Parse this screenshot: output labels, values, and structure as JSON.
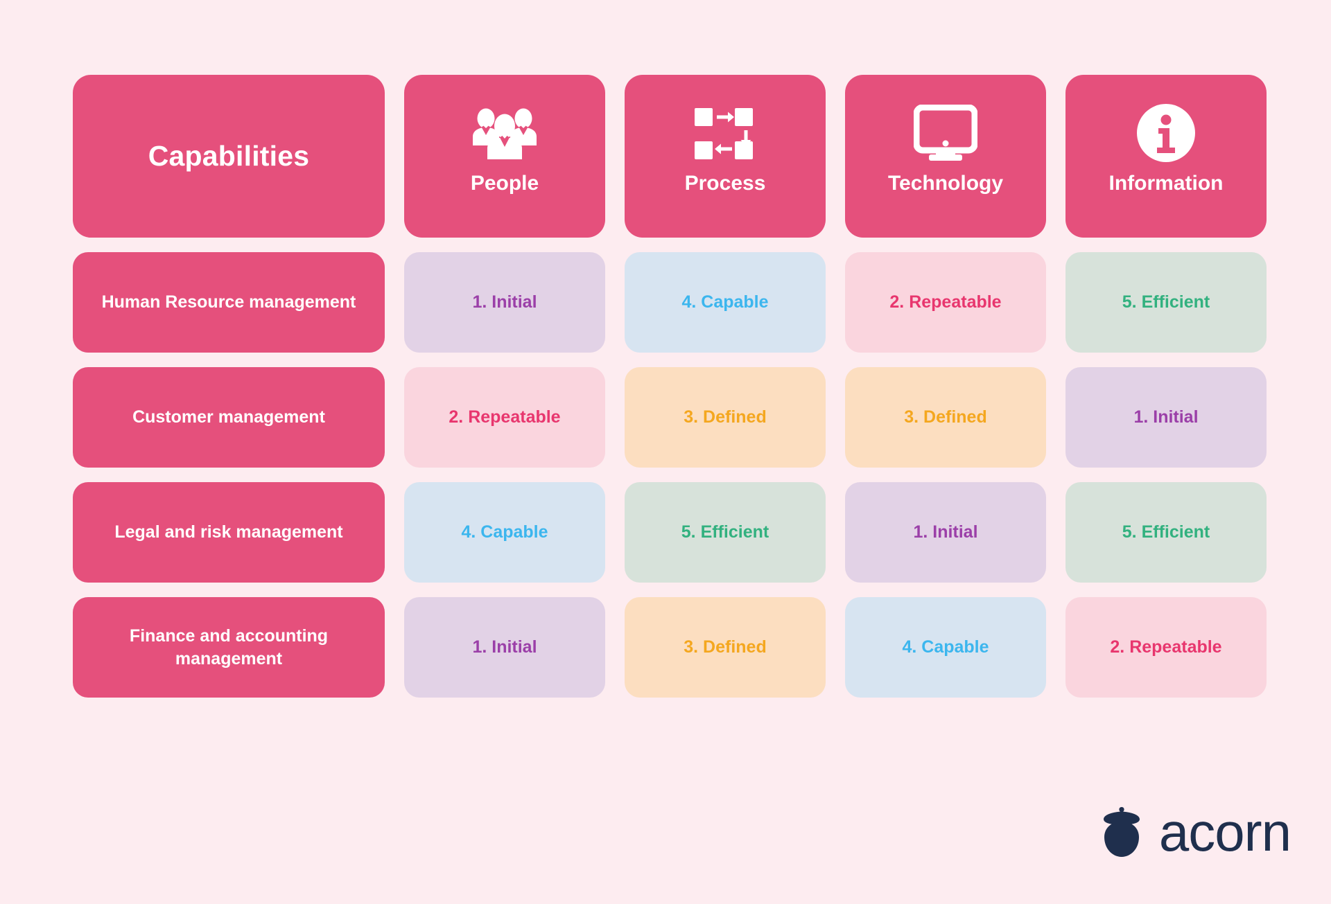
{
  "background_color": "#fdecf0",
  "brand_color": "#e5507c",
  "header": {
    "title": "Capabilities",
    "columns": [
      {
        "label": "People",
        "icon": "people-group-icon"
      },
      {
        "label": "Process",
        "icon": "process-flow-icon"
      },
      {
        "label": "Technology",
        "icon": "desktop-monitor-icon"
      },
      {
        "label": "Information",
        "icon": "info-circle-icon"
      }
    ]
  },
  "legend_levels": [
    {
      "level": 1,
      "label": "1. Initial",
      "bg": "#e2d2e6",
      "fg": "#9b3fa8"
    },
    {
      "level": 2,
      "label": "2. Repeatable",
      "bg": "#fad5de",
      "fg": "#e8366e"
    },
    {
      "level": 3,
      "label": "3. Defined",
      "bg": "#fcdec0",
      "fg": "#f4a71f"
    },
    {
      "level": 4,
      "label": "4. Capable",
      "bg": "#d7e4f1",
      "fg": "#3cb6ee"
    },
    {
      "level": 5,
      "label": "5. Efficient",
      "bg": "#d7e2da",
      "fg": "#32b17f"
    }
  ],
  "rows": [
    {
      "label": "Human Resource management",
      "cells": [
        {
          "level": 1,
          "label": "1. Initial"
        },
        {
          "level": 4,
          "label": "4. Capable"
        },
        {
          "level": 2,
          "label": "2. Repeatable"
        },
        {
          "level": 5,
          "label": "5. Efficient"
        }
      ]
    },
    {
      "label": "Customer management",
      "cells": [
        {
          "level": 2,
          "label": "2. Repeatable"
        },
        {
          "level": 3,
          "label": "3. Defined"
        },
        {
          "level": 3,
          "label": "3. Defined"
        },
        {
          "level": 1,
          "label": "1. Initial"
        }
      ]
    },
    {
      "label": "Legal and risk management",
      "cells": [
        {
          "level": 4,
          "label": "4. Capable"
        },
        {
          "level": 5,
          "label": "5. Efficient"
        },
        {
          "level": 1,
          "label": "1. Initial"
        },
        {
          "level": 5,
          "label": "5. Efficient"
        }
      ]
    },
    {
      "label": "Finance and accounting management",
      "cells": [
        {
          "level": 1,
          "label": "1. Initial"
        },
        {
          "level": 3,
          "label": "3. Defined"
        },
        {
          "level": 4,
          "label": "4. Capable"
        },
        {
          "level": 2,
          "label": "2. Repeatable"
        }
      ]
    }
  ],
  "logo": {
    "word": "acorn",
    "icon": "acorn-icon",
    "color": "#1f2f4d"
  },
  "chart_data": {
    "type": "table",
    "title": "Capabilities",
    "categories": [
      "People",
      "Process",
      "Technology",
      "Information"
    ],
    "row_labels": [
      "Human Resource management",
      "Customer management",
      "Legal and risk management",
      "Finance and accounting management"
    ],
    "scale": [
      "1. Initial",
      "2. Repeatable",
      "3. Defined",
      "4. Capable",
      "5. Efficient"
    ],
    "series": [
      {
        "name": "Human Resource management",
        "values": [
          1,
          4,
          2,
          5
        ]
      },
      {
        "name": "Customer management",
        "values": [
          2,
          3,
          3,
          1
        ]
      },
      {
        "name": "Legal and risk management",
        "values": [
          4,
          5,
          1,
          5
        ]
      },
      {
        "name": "Finance and accounting management",
        "values": [
          1,
          3,
          4,
          2
        ]
      }
    ]
  }
}
